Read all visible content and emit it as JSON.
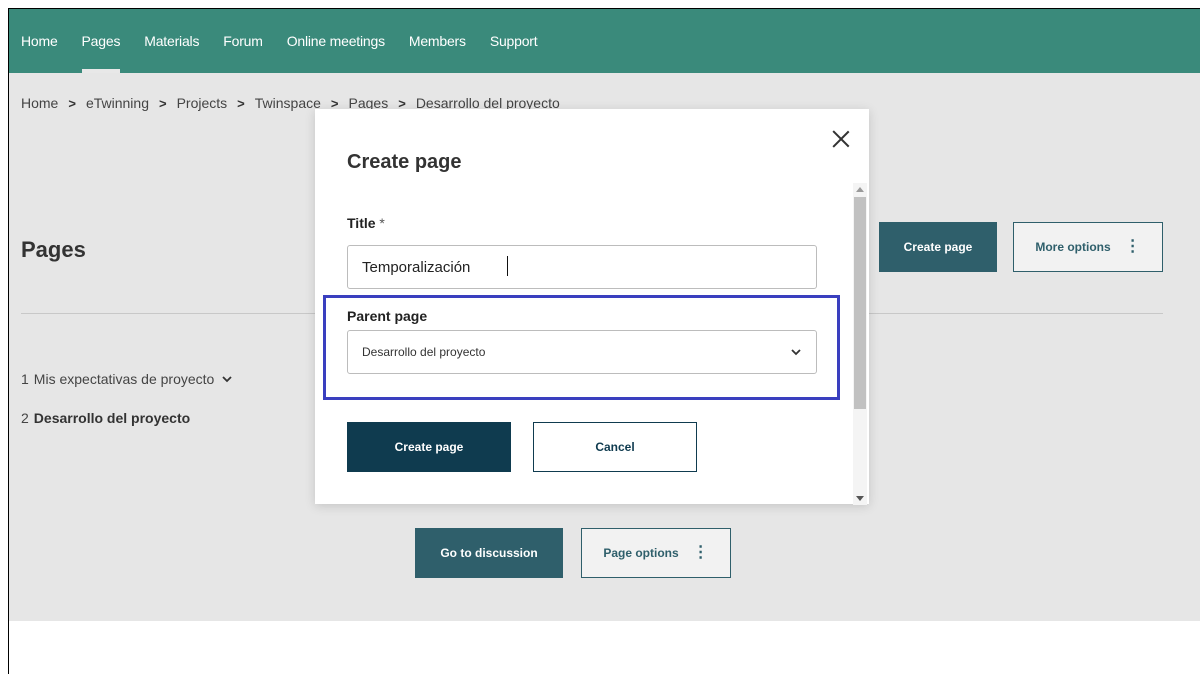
{
  "nav": {
    "items": [
      {
        "label": "Home"
      },
      {
        "label": "Pages"
      },
      {
        "label": "Materials"
      },
      {
        "label": "Forum"
      },
      {
        "label": "Online meetings"
      },
      {
        "label": "Members"
      },
      {
        "label": "Support"
      }
    ],
    "active": "Pages"
  },
  "breadcrumb": {
    "items": [
      "Home",
      "eTwinning",
      "Projects",
      "Twinspace",
      "Pages",
      "Desarrollo del proyecto"
    ],
    "separator": ">"
  },
  "page": {
    "title": "Pages",
    "create_button": "Create page",
    "more_options_button": "More options",
    "tree": [
      {
        "number": "1",
        "label": "Mis expectativas de proyecto"
      },
      {
        "number": "2",
        "label": "Desarrollo del proyecto"
      }
    ],
    "discussion_button": "Go to discussion",
    "page_options_button": "Page options"
  },
  "modal": {
    "title": "Create page",
    "title_field_label": "Title",
    "required_mark": "*",
    "title_value": "Temporalización",
    "parent_label": "Parent page",
    "parent_value": "Desarrollo del proyecto",
    "create_button": "Create page",
    "cancel_button": "Cancel"
  },
  "colors": {
    "nav_bg": "#3a8a7b",
    "primary": "#0f3b4f",
    "highlight": "#3a3fbf"
  },
  "icons": {
    "close": "close-icon",
    "chevron": "chevron-down-icon",
    "kebab": "kebab-menu-icon"
  }
}
